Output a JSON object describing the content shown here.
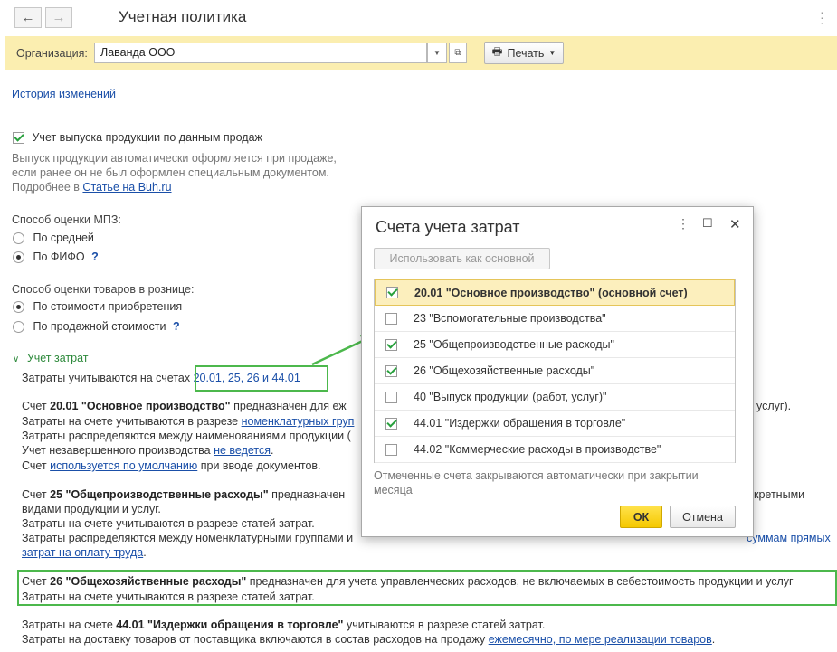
{
  "window": {
    "title": "Учетная политика"
  },
  "org": {
    "label": "Организация:",
    "value": "Лаванда ООО",
    "print": "Печать"
  },
  "history_link": "История изменений",
  "sales_output": {
    "checkbox_label": "Учет выпуска продукции по данным продаж",
    "hint_line1": "Выпуск продукции автоматически оформляется при продаже,",
    "hint_line2": "если ранее он не был оформлен специальным документом.",
    "more_prefix": "Подробнее в ",
    "more_link": "Статье на Buh.ru"
  },
  "mpz": {
    "label": "Способ оценки МПЗ:",
    "opt_avg": "По средней",
    "opt_fifo": "По ФИФО",
    "help": "?"
  },
  "retail": {
    "label": "Способ оценки товаров в рознице:",
    "opt_cost": "По стоимости приобретения",
    "opt_sale": "По продажной стоимости",
    "help": "?"
  },
  "costs": {
    "section": "Учет затрат",
    "accounts_prefix": "Затраты учитываются на счетах ",
    "accounts_link": "20.01, 25, 26 и 44.01",
    "s20_prefix": "Счет ",
    "s20_name": "20.01 \"Основное производство\"",
    "s20_text": " предназначен для еж",
    "s20_tail": "услуг).",
    "s20_l2a": "Затраты на счете учитываются в разрезе ",
    "s20_l2link": "номенклатурных груп",
    "s20_l3": "Затраты распределяются между наименованиями продукции (",
    "s20_l4a": "Учет незавершенного производства ",
    "s20_l4link": "не ведется",
    "s20_l4b": ".",
    "s20_l5a": "Счет ",
    "s20_l5link": "используется по умолчанию",
    "s20_l5b": " при вводе документов.",
    "s25_prefix": "Счет ",
    "s25_name": "25 \"Общепроизводственные расходы\"",
    "s25_text": " предназначен",
    "s25_tail": "кретными",
    "s25_l2": "видами продукции и услуг.",
    "s25_l3": "Затраты на счете учитываются в разрезе статей затрат.",
    "s25_l4": "Затраты распределяются между номенклатурными группами и",
    "s25_l4link": "суммам прямых",
    "s25_l5link": "затрат на оплату труда",
    "s25_l5b": ".",
    "s26_prefix": "Счет ",
    "s26_name": "26 \"Общехозяйственные расходы\"",
    "s26_text": " предназначен для учета управленческих расходов, не включаемых в себестоимость продукции и услуг",
    "s26_l2": "Затраты на счете учитываются в разрезе статей затрат.",
    "s44_prefix": "Затраты на счете ",
    "s44_name": "44.01 \"Издержки обращения в торговле\"",
    "s44_text": " учитываются в разрезе статей затрат.",
    "s44_l2a": "Затраты на доставку товаров от поставщика включаются в состав расходов на продажу ",
    "s44_l2link": "ежемесячно, по мере реализации товаров",
    "s44_l2b": "."
  },
  "dialog": {
    "title": "Счета учета затрат",
    "use_as_main": "Использовать как основной",
    "accounts": [
      {
        "label": "20.01 \"Основное производство\" (основной счет)",
        "checked": true
      },
      {
        "label": "23 \"Вспомогательные производства\"",
        "checked": false
      },
      {
        "label": "25 \"Общепроизводственные расходы\"",
        "checked": true
      },
      {
        "label": "26 \"Общехозяйственные расходы\"",
        "checked": true
      },
      {
        "label": "40 \"Выпуск продукции (работ, услуг)\"",
        "checked": false
      },
      {
        "label": "44.01 \"Издержки обращения в торговле\"",
        "checked": true
      },
      {
        "label": "44.02 \"Коммерческие расходы в производстве\"",
        "checked": false
      }
    ],
    "note": "Отмеченные счета закрываются автоматически при закрытии месяца",
    "ok": "ОК",
    "cancel": "Отмена"
  },
  "colors": {
    "accent_yellow": "#fbeeb0",
    "highlight_green": "#4cb84c",
    "link": "#1a4fa8"
  }
}
